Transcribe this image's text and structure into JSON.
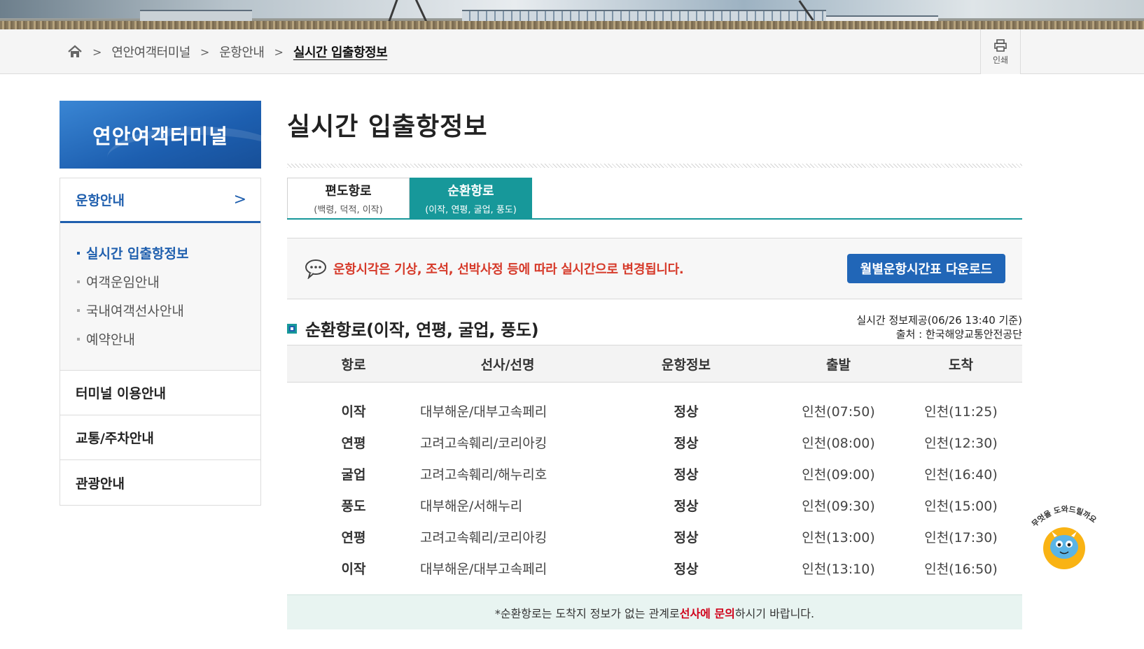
{
  "breadcrumb": {
    "items": [
      "연안여객터미널",
      "운항안내"
    ],
    "current": "실시간 입출항정보"
  },
  "print_label": "인쇄",
  "sidebar": {
    "title": "연안여객터미널",
    "menus": [
      {
        "label": "운항안내",
        "sub": [
          "실시간 입출항정보",
          "여객운임안내",
          "국내여객선사안내",
          "예약안내"
        ]
      },
      {
        "label": "터미널 이용안내"
      },
      {
        "label": "교통/주차안내"
      },
      {
        "label": "관광안내"
      }
    ]
  },
  "page_title": "실시간 입출항정보",
  "tabs": [
    {
      "label": "편도항로",
      "sub": "(백령, 덕적, 이작)"
    },
    {
      "label": "순환항로",
      "sub": "(이작, 연평, 굴업, 풍도)"
    }
  ],
  "notice": {
    "message": "운항시각은 기상, 조석, 선박사정 등에 따라 실시간으로 변경됩니다.",
    "download_label": "월별운항시간표 다운로드"
  },
  "section": {
    "title": "순환항로(이작, 연평, 굴업, 풍도)",
    "realtime": "실시간 정보제공(06/26 13:40 기준)",
    "source": "출처 : 한국해양교통안전공단"
  },
  "table": {
    "headers": [
      "항로",
      "선사/선명",
      "운항정보",
      "출발",
      "도착"
    ],
    "rows": [
      [
        "이작",
        "대부해운/대부고속페리",
        "정상",
        "인천(07:50)",
        "인천(11:25)"
      ],
      [
        "연평",
        "고려고속훼리/코리아킹",
        "정상",
        "인천(08:00)",
        "인천(12:30)"
      ],
      [
        "굴업",
        "고려고속훼리/해누리호",
        "정상",
        "인천(09:00)",
        "인천(16:40)"
      ],
      [
        "풍도",
        "대부해운/서해누리",
        "정상",
        "인천(09:30)",
        "인천(15:00)"
      ],
      [
        "연평",
        "고려고속훼리/코리아킹",
        "정상",
        "인천(13:00)",
        "인천(17:30)"
      ],
      [
        "이작",
        "대부해운/대부고속페리",
        "정상",
        "인천(13:10)",
        "인천(16:50)"
      ]
    ]
  },
  "footnote": {
    "pre": "*순환항로는 도착지 정보가 없는 관계로 ",
    "emphasis": "선사에 문의",
    "post": "하시기 바랍니다."
  },
  "mascot": {
    "speech": "무엇을 도와드릴까요?"
  },
  "colors": {
    "teal": "#17989a",
    "blue": "#1f5fae",
    "red": "#d63a2a"
  },
  "icons": [
    "home-icon",
    "print-icon",
    "chat-bubble-icon",
    "chevron-right-icon",
    "chatbot-mascot-icon"
  ]
}
